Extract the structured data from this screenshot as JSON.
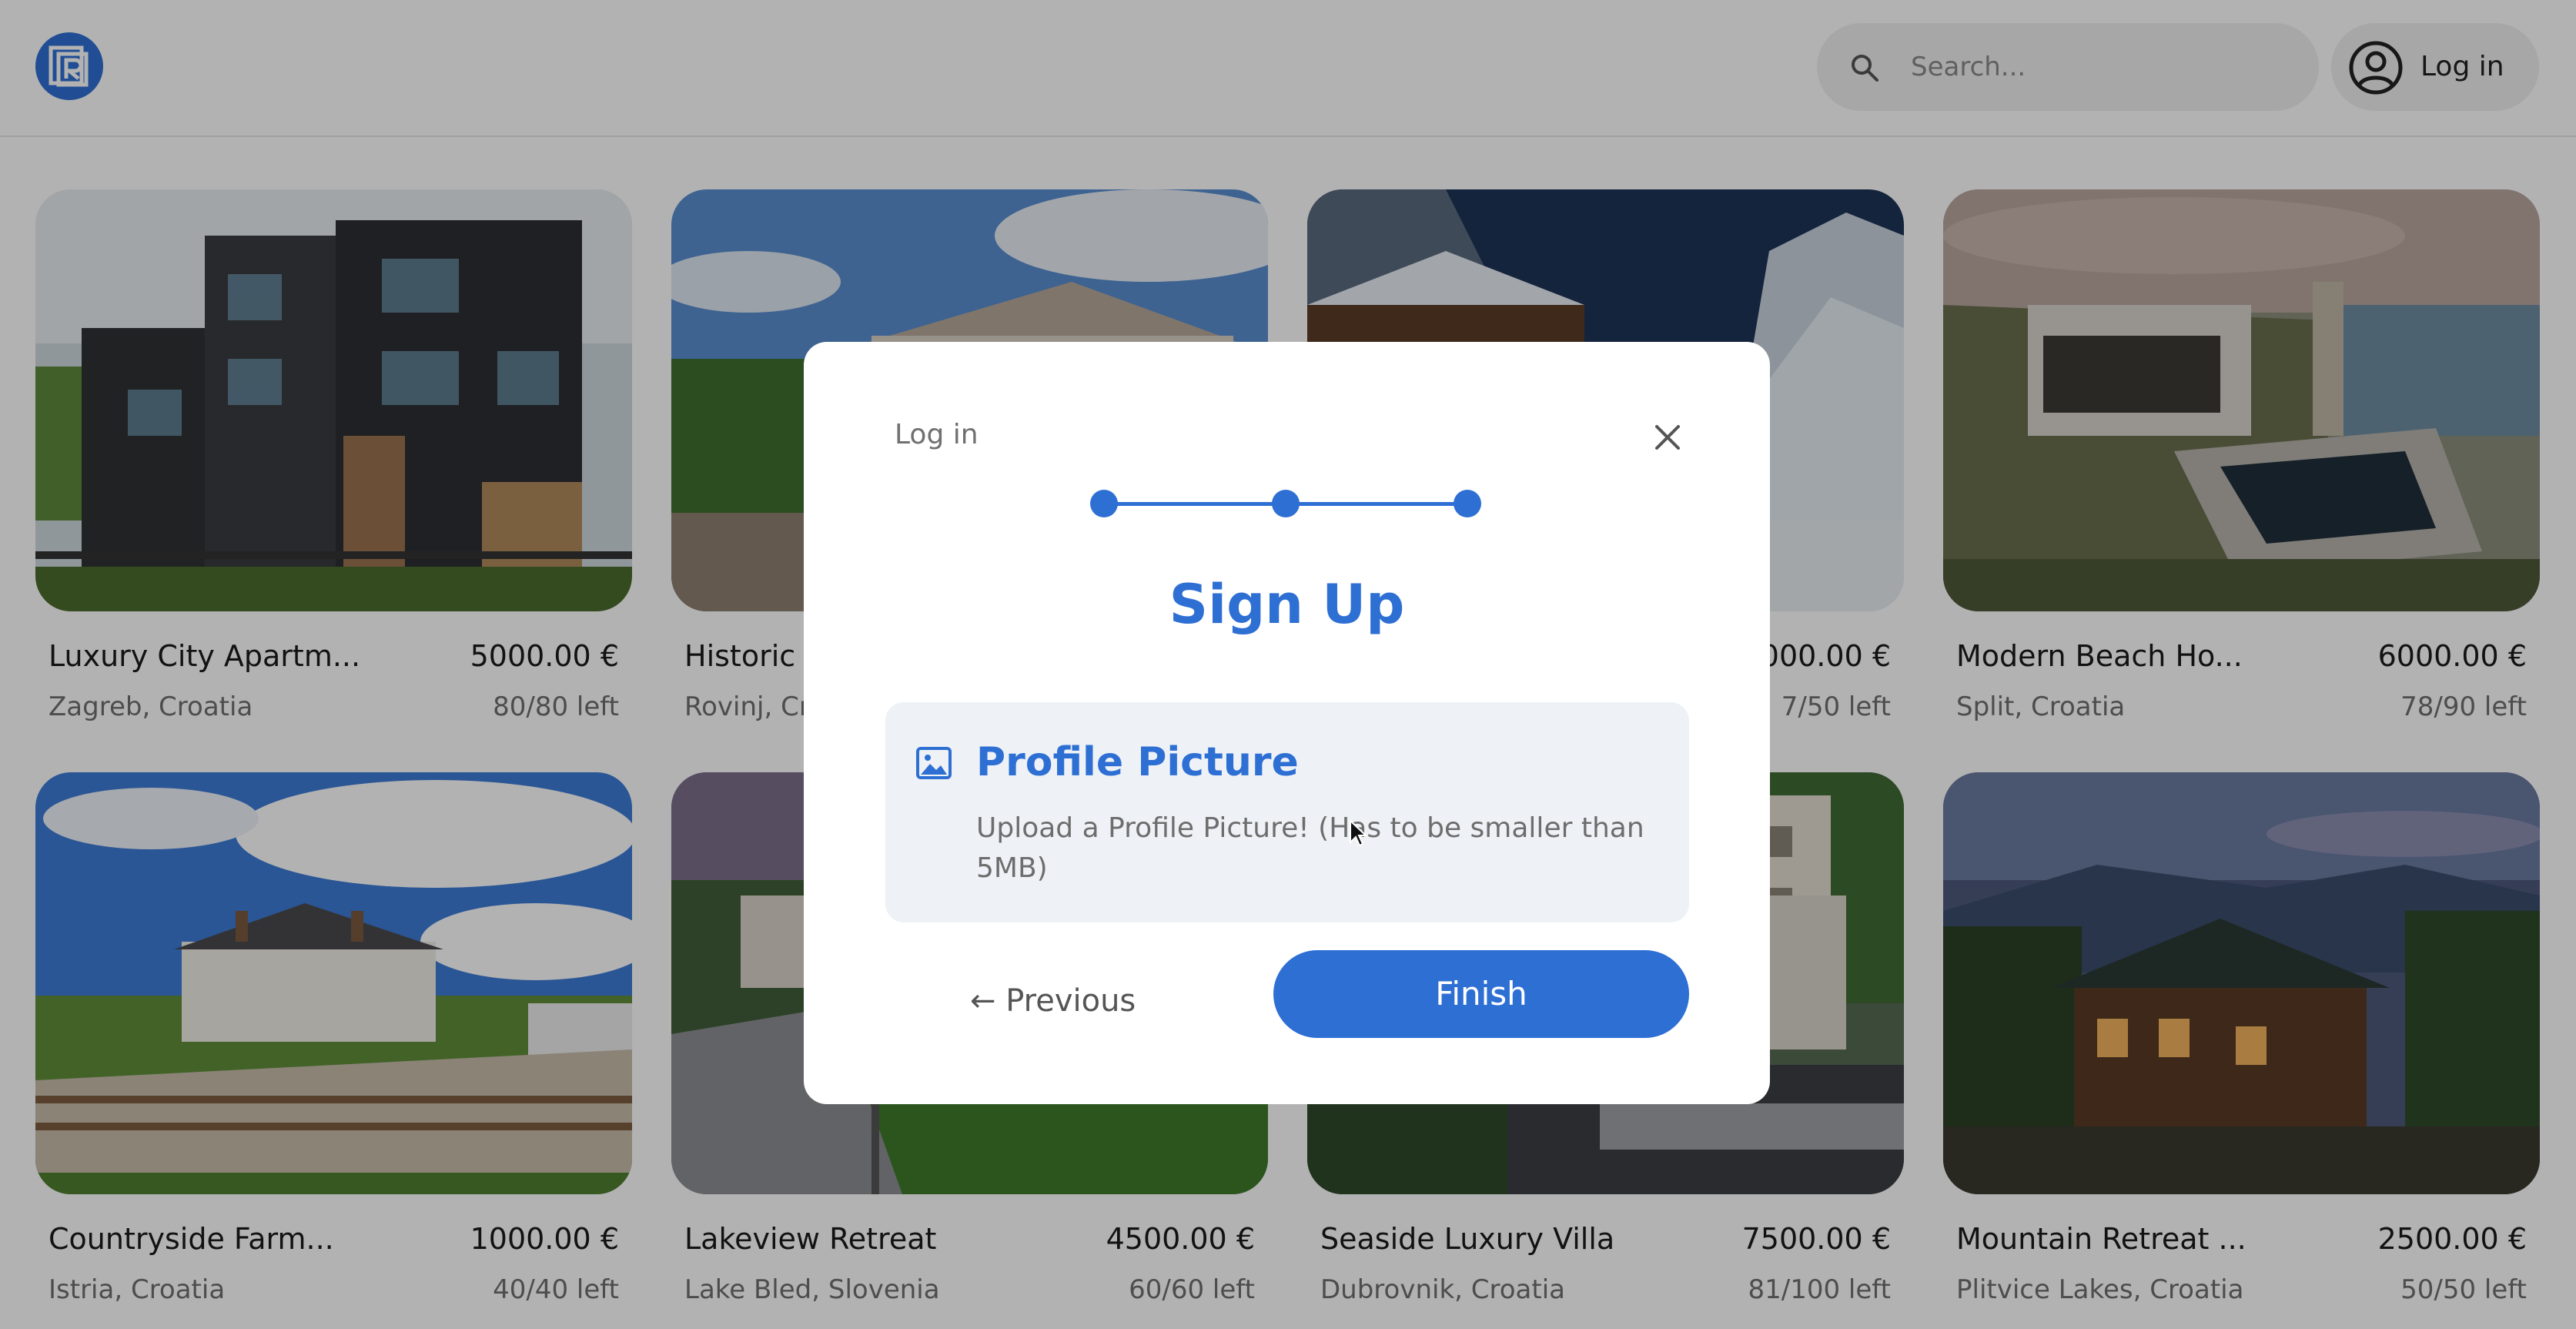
{
  "header": {
    "logo_icon": "building-logo-icon",
    "search": {
      "placeholder": "Search...",
      "icon": "search-icon"
    },
    "login": {
      "label": "Log in",
      "icon": "user-circle-icon"
    }
  },
  "listings": [
    {
      "name": "Luxury City Apartm...",
      "price": "5000.00 €",
      "location": "Zagreb, Croatia",
      "availability": "80/80 left"
    },
    {
      "name": "Historic",
      "price": "",
      "location": "Rovinj, Cr",
      "availability": ""
    },
    {
      "name": "",
      "price": "000.00 €",
      "location": "",
      "availability": "7/50 left"
    },
    {
      "name": "Modern Beach Ho...",
      "price": "6000.00 €",
      "location": "Split, Croatia",
      "availability": "78/90 left"
    },
    {
      "name": "Countryside Farm...",
      "price": "1000.00 €",
      "location": "Istria, Croatia",
      "availability": "40/40 left"
    },
    {
      "name": "Lakeview Retreat",
      "price": "4500.00 €",
      "location": "Lake Bled, Slovenia",
      "availability": "60/60 left"
    },
    {
      "name": "Seaside Luxury Villa",
      "price": "7500.00 €",
      "location": "Dubrovnik, Croatia",
      "availability": "81/100 left"
    },
    {
      "name": "Mountain Retreat ...",
      "price": "2500.00 €",
      "location": "Plitvice Lakes, Croatia",
      "availability": "50/50 left"
    }
  ],
  "modal": {
    "title": "Log in",
    "close_icon": "close-icon",
    "heading": "Sign Up",
    "steps": 3,
    "section": {
      "icon": "image-icon",
      "title": "Profile Picture",
      "description": "Upload a Profile Picture! (Has to be smaller than 5MB)"
    },
    "previous_label": "← Previous",
    "finish_label": "Finish"
  },
  "colors": {
    "accent": "#2e6fd4",
    "panel_bg": "#eef2f6",
    "overlay": "rgba(0,0,0,0.30)"
  }
}
